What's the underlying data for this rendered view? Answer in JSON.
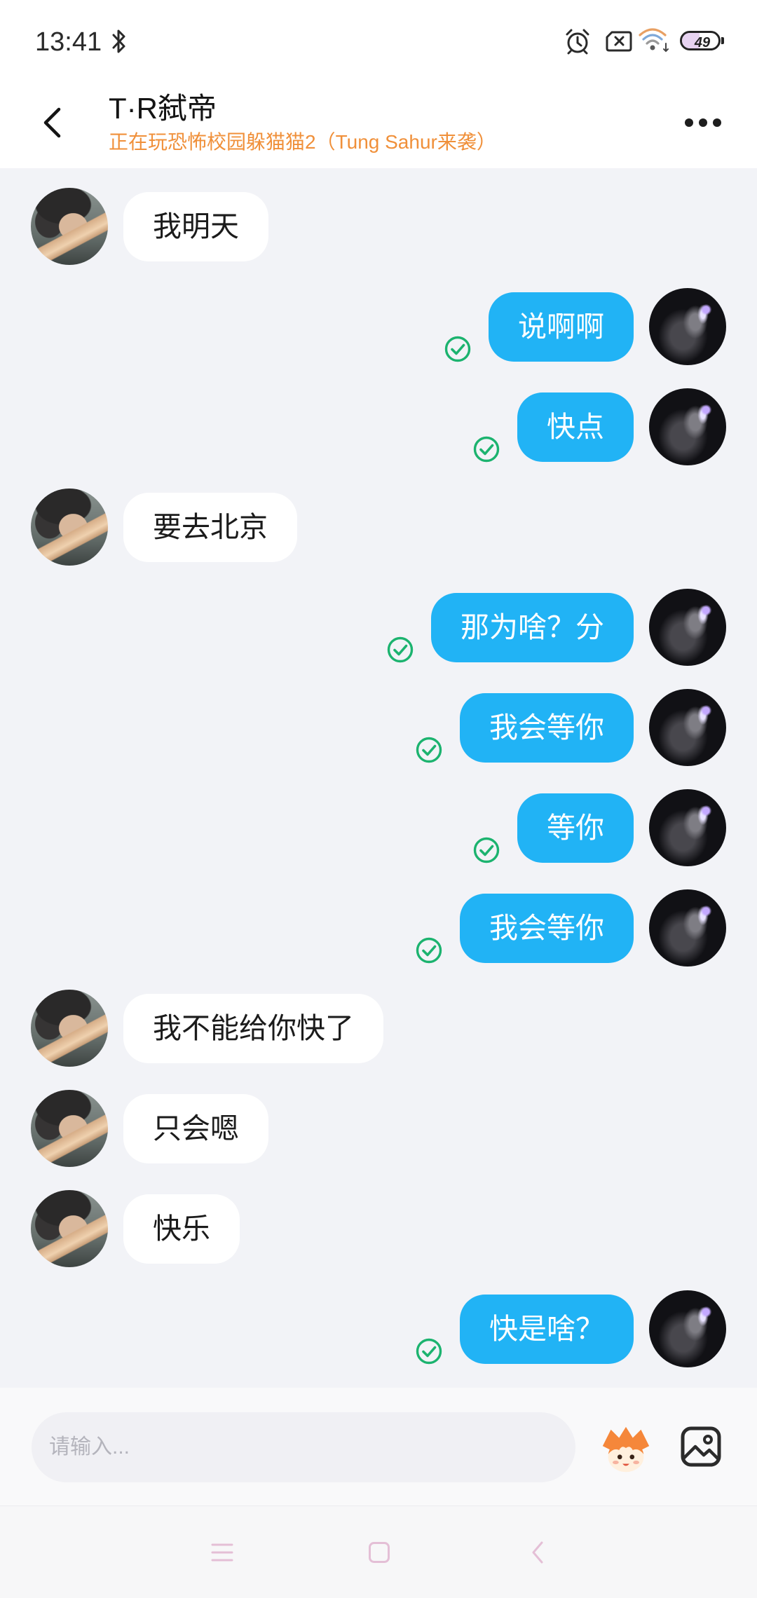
{
  "status_bar": {
    "time": "13:41",
    "battery_level": "49",
    "icons": [
      "bluetooth-icon",
      "alarm-icon",
      "no-sim-icon",
      "wifi-icon",
      "battery-icon"
    ]
  },
  "header": {
    "title": "T·R弑帝",
    "subtitle": "正在玩恐怖校园躲猫猫2（Tung Sahur来袭）",
    "back_icon": "chevron-left-icon",
    "more_icon": "more-horizontal-icon"
  },
  "messages": [
    {
      "outgoing": false,
      "text": "我明天"
    },
    {
      "outgoing": true,
      "text": "说啊啊",
      "status_icon": "check-circle-icon"
    },
    {
      "outgoing": true,
      "text": "快点",
      "status_icon": "check-circle-icon"
    },
    {
      "outgoing": false,
      "text": "要去北京"
    },
    {
      "outgoing": true,
      "text": "那为啥？分",
      "status_icon": "check-circle-icon"
    },
    {
      "outgoing": true,
      "text": "我会等你",
      "status_icon": "check-circle-icon"
    },
    {
      "outgoing": true,
      "text": "等你",
      "status_icon": "check-circle-icon"
    },
    {
      "outgoing": true,
      "text": "我会等你",
      "status_icon": "check-circle-icon"
    },
    {
      "outgoing": false,
      "text": "我不能给你快了"
    },
    {
      "outgoing": false,
      "text": "只会嗯"
    },
    {
      "outgoing": false,
      "text": "快乐"
    },
    {
      "outgoing": true,
      "text": "快是啥？",
      "status_icon": "check-circle-icon"
    }
  ],
  "composer": {
    "placeholder": "请输入...",
    "emoji_icon": "emoji-mascot-icon",
    "image_icon": "image-icon"
  },
  "nav_bar": {
    "icons": [
      "menu-icon",
      "home-icon",
      "back-icon"
    ]
  },
  "colors": {
    "accent": "#21b3f5",
    "chat_background": "#f2f3f7",
    "subtitle": "#f0903a",
    "status_check": "#1cb36f",
    "nav_icon": "#e4bfd6"
  }
}
